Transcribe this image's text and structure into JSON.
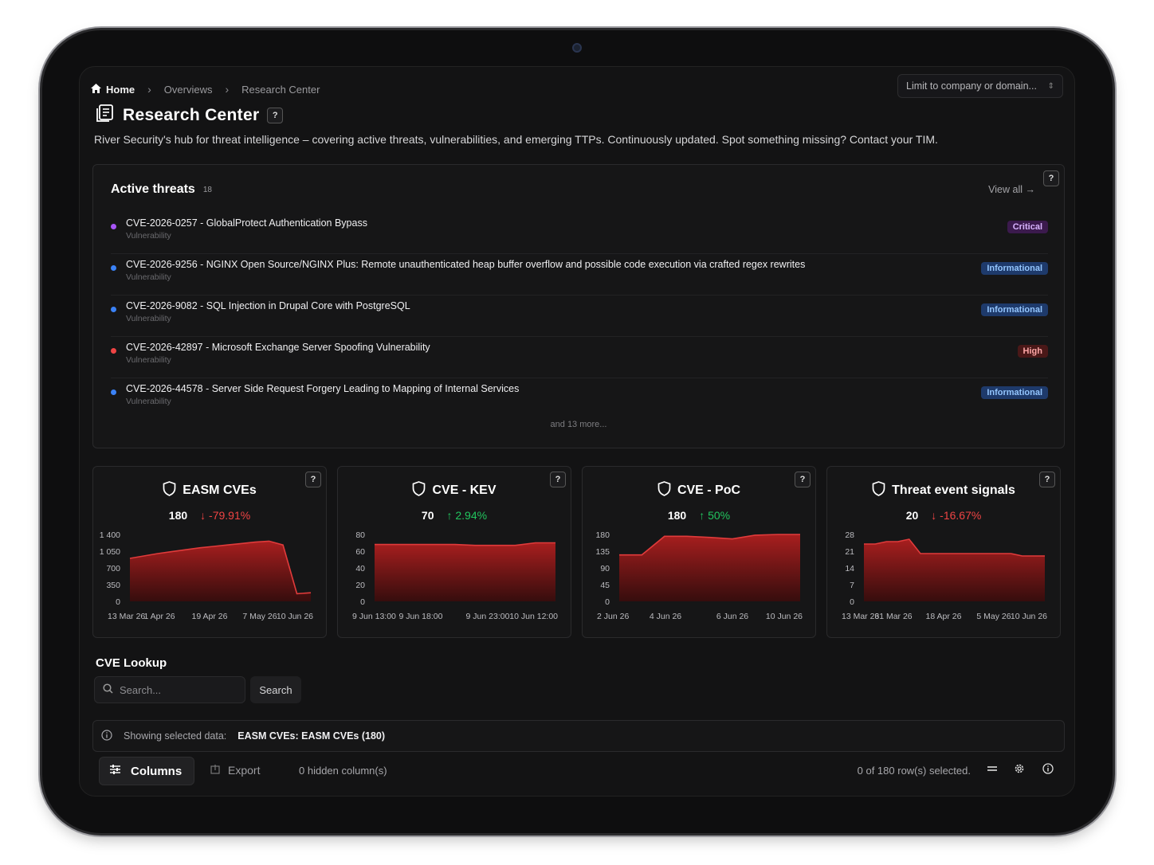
{
  "breadcrumb": {
    "home": "Home",
    "items": [
      "Overviews",
      "Research Center"
    ]
  },
  "limit_select": {
    "placeholder": "Limit to company or domain..."
  },
  "page": {
    "title": "Research Center",
    "help": "?",
    "description": "River Security's hub for threat intelligence – covering active threats, vulnerabilities, and emerging TTPs. Continuously updated. Spot something missing? Contact your TIM."
  },
  "threats": {
    "title": "Active threats",
    "count": "18",
    "view_all": "View all",
    "more": "and 13 more...",
    "items": [
      {
        "title": "CVE-2026-0257 - GlobalProtect Authentication Bypass",
        "type": "Vulnerability",
        "severity": "Critical",
        "color": "#a855f7"
      },
      {
        "title": "CVE-2026-9256 - NGINX Open Source/NGINX Plus: Remote unauthenticated heap buffer overflow and possible code execution via crafted regex rewrites",
        "type": "Vulnerability",
        "severity": "Informational",
        "color": "#3b82f6"
      },
      {
        "title": "CVE-2026-9082 - SQL Injection in Drupal Core with PostgreSQL",
        "type": "Vulnerability",
        "severity": "Informational",
        "color": "#3b82f6"
      },
      {
        "title": "CVE-2026-42897 - Microsoft Exchange Server Spoofing Vulnerability",
        "type": "Vulnerability",
        "severity": "High",
        "color": "#ef4444"
      },
      {
        "title": "CVE-2026-44578 - Server Side Request Forgery Leading to Mapping of Internal Services",
        "type": "Vulnerability",
        "severity": "Informational",
        "color": "#3b82f6"
      }
    ]
  },
  "cards": [
    {
      "title": "EASM CVEs",
      "value": "180",
      "change": "-79.91%",
      "direction": "down"
    },
    {
      "title": "CVE - KEV",
      "value": "70",
      "change": "2.94%",
      "direction": "up"
    },
    {
      "title": "CVE - PoC",
      "value": "180",
      "change": "50%",
      "direction": "up"
    },
    {
      "title": "Threat event signals",
      "value": "20",
      "change": "-16.67%",
      "direction": "down"
    }
  ],
  "chart_data": [
    {
      "type": "area",
      "yticks": [
        "1 400",
        "1 050",
        "700",
        "350",
        "0"
      ],
      "ylim": [
        0,
        1400
      ],
      "xticks": [
        "13 Mar 26",
        "1 Apr 26",
        "19 Apr 26",
        "7 May 26",
        "10 Jun 26"
      ],
      "values": [
        900,
        950,
        1000,
        1040,
        1080,
        1120,
        1150,
        1180,
        1210,
        1240,
        1260,
        1180,
        160,
        180
      ]
    },
    {
      "type": "area",
      "yticks": [
        "80",
        "60",
        "40",
        "20",
        "0"
      ],
      "ylim": [
        0,
        80
      ],
      "xticks": [
        "9 Jun 13:00",
        "9 Jun 18:00",
        "9 Jun 23:00",
        "10 Jun 12:00"
      ],
      "values": [
        68,
        68,
        68,
        68,
        68,
        67,
        67,
        67,
        70,
        70
      ]
    },
    {
      "type": "area",
      "yticks": [
        "180",
        "135",
        "90",
        "45",
        "0"
      ],
      "ylim": [
        0,
        180
      ],
      "xticks": [
        "2 Jun 26",
        "4 Jun 26",
        "6 Jun 26",
        "10 Jun 26"
      ],
      "values": [
        125,
        125,
        175,
        175,
        172,
        168,
        178,
        180,
        180
      ]
    },
    {
      "type": "area",
      "yticks": [
        "28",
        "21",
        "14",
        "7",
        "0"
      ],
      "ylim": [
        0,
        28
      ],
      "xticks": [
        "13 Mar 26",
        "31 Mar 26",
        "18 Apr 26",
        "5 May 26",
        "10 Jun 26"
      ],
      "values": [
        24,
        24,
        25,
        25,
        26,
        20,
        20,
        20,
        20,
        20,
        20,
        20,
        20,
        20,
        19,
        19,
        19
      ]
    }
  ],
  "lookup": {
    "title": "CVE Lookup",
    "placeholder": "Search...",
    "button": "Search"
  },
  "selected": {
    "label": "Showing selected data:",
    "value": "EASM CVEs: EASM CVEs (180)"
  },
  "toolbar": {
    "columns": "Columns",
    "export": "Export",
    "hidden": "0 hidden column(s)",
    "rows": "0 of 180 row(s) selected."
  },
  "colors": {
    "up": "#22c55e",
    "down": "#ef4444",
    "area": "#a01a1a",
    "line": "#e03b3b"
  }
}
